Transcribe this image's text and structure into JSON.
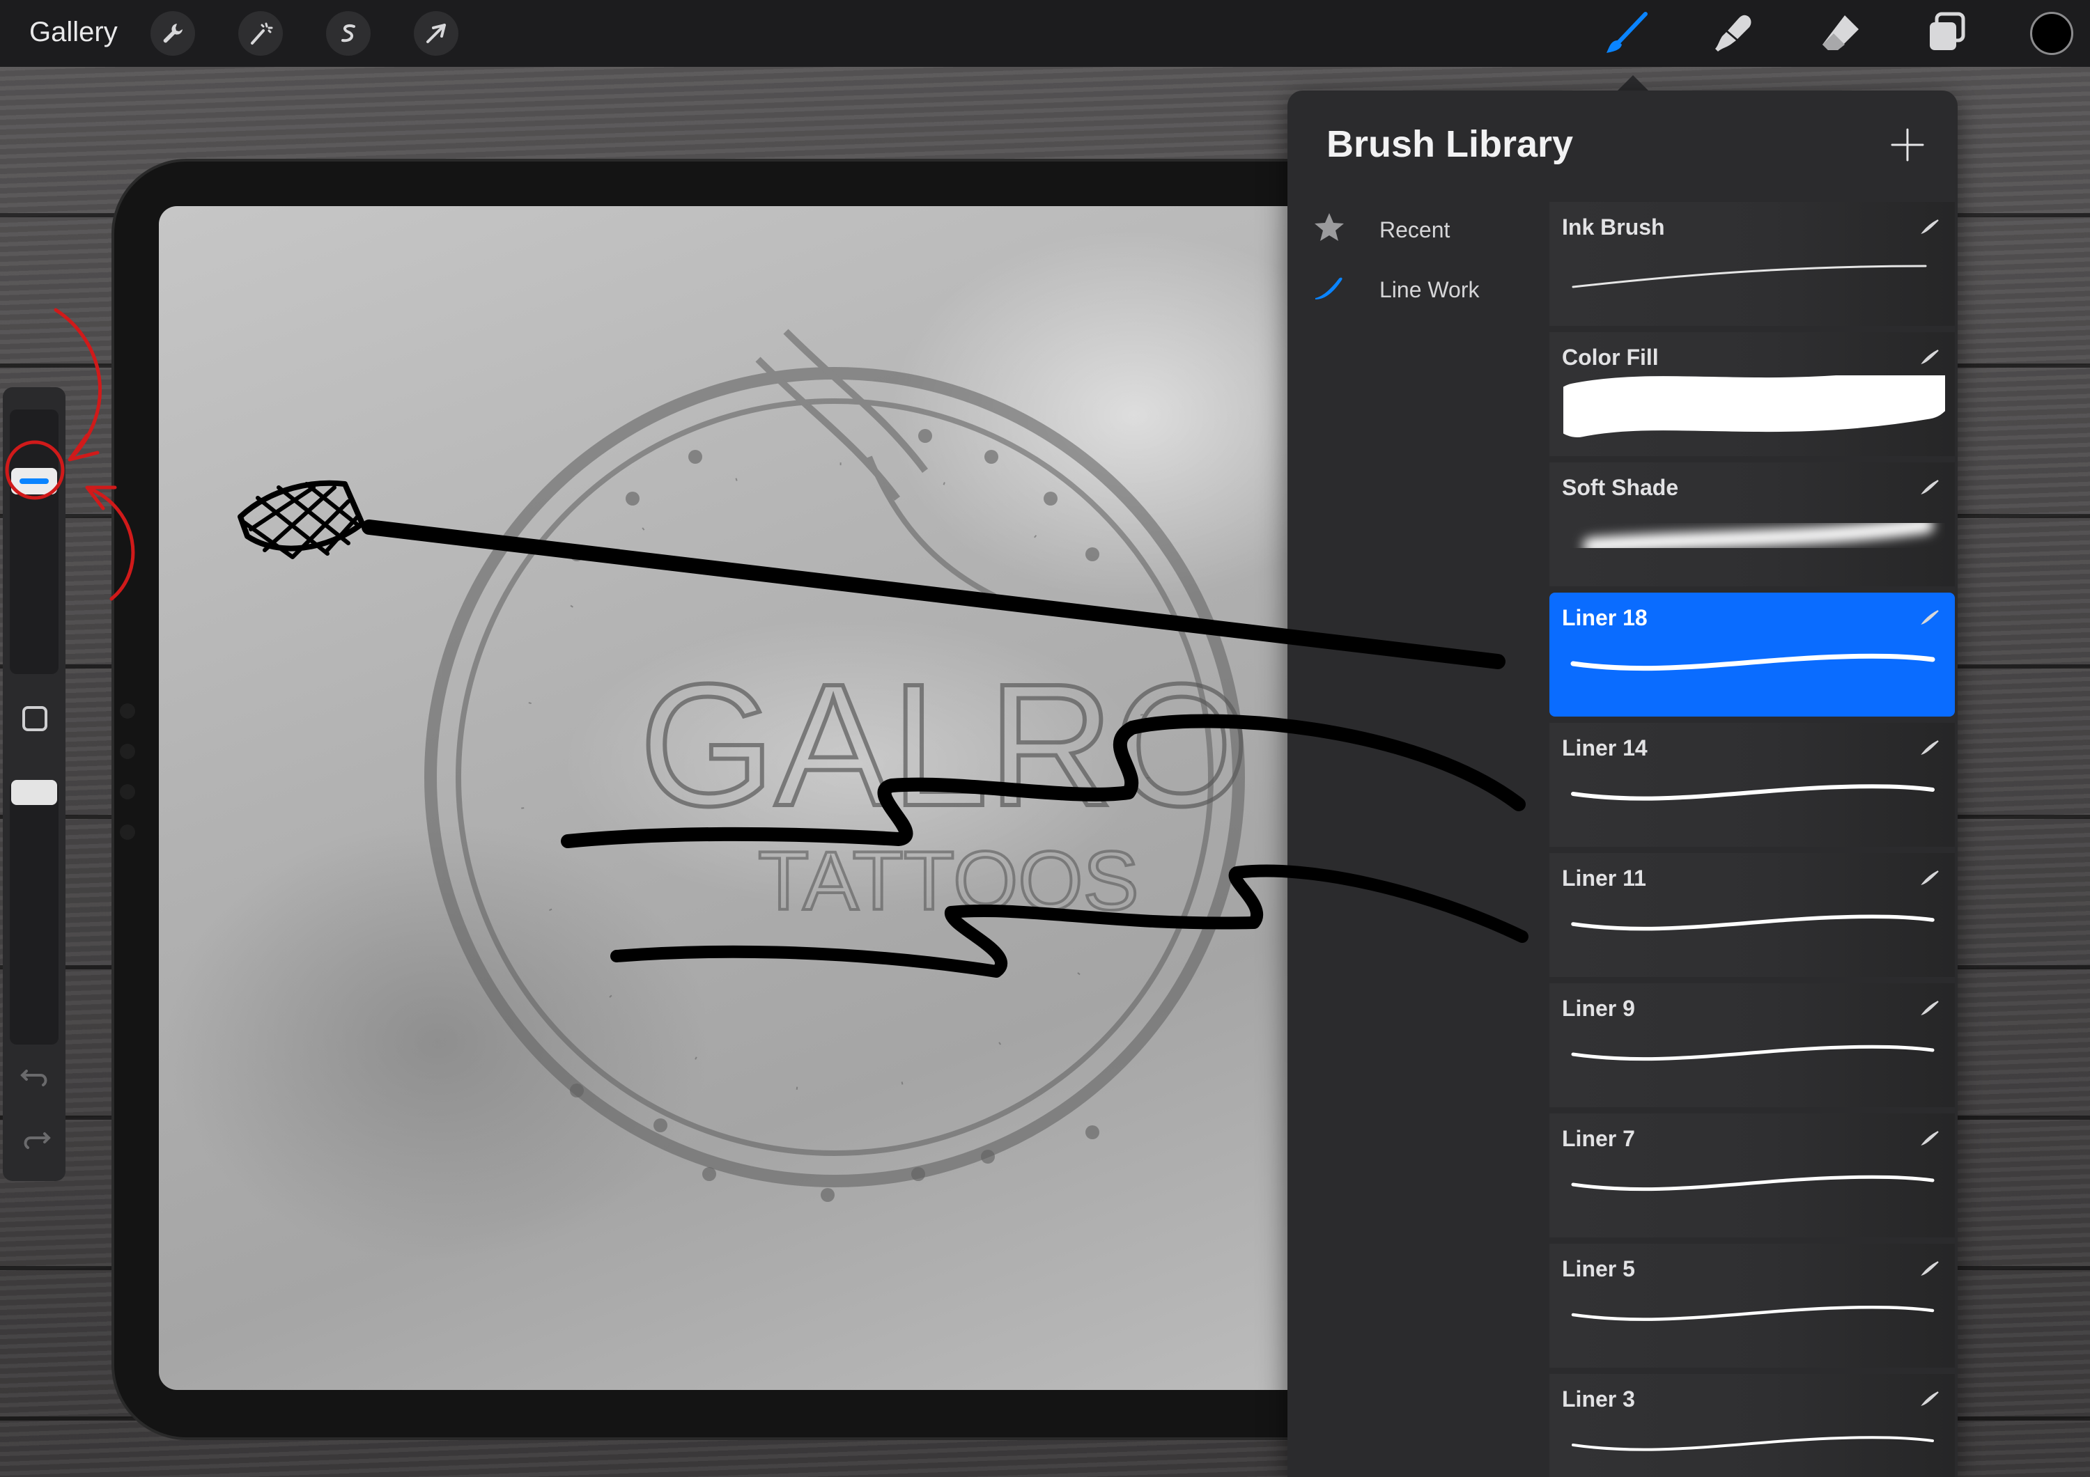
{
  "topbar": {
    "gallery_label": "Gallery",
    "left_tools": [
      "wrench-icon",
      "magic-wand-icon",
      "selection-icon",
      "transform-arrow-icon"
    ],
    "right_tools": [
      "brush-icon",
      "smudge-icon",
      "eraser-icon",
      "layers-icon",
      "color-swatch"
    ],
    "active_tool_color": "#0a84ff",
    "current_color": "#000000"
  },
  "brush_library": {
    "title": "Brush Library",
    "categories": [
      {
        "label": "Recent",
        "icon": "star-icon"
      },
      {
        "label": "Line Work",
        "icon": "brush-stroke-icon"
      }
    ],
    "brushes": [
      {
        "name": "Ink Brush",
        "selected": false
      },
      {
        "name": "Color Fill",
        "selected": false
      },
      {
        "name": "Soft Shade",
        "selected": false
      },
      {
        "name": "Liner 18",
        "selected": true
      },
      {
        "name": "Liner 14",
        "selected": false
      },
      {
        "name": "Liner 11",
        "selected": false
      },
      {
        "name": "Liner 9",
        "selected": false
      },
      {
        "name": "Liner 7",
        "selected": false
      },
      {
        "name": "Liner 5",
        "selected": false
      },
      {
        "name": "Liner 3",
        "selected": false
      }
    ],
    "selection_color": "#0a6cff"
  },
  "sidebar": {
    "brush_size_knob_color": "#0a84ff"
  },
  "canvas": {
    "logo_text": "GALRO",
    "logo_subtext": "TATTOOS"
  },
  "annotations": {
    "circle_color": "#d01a1a"
  }
}
